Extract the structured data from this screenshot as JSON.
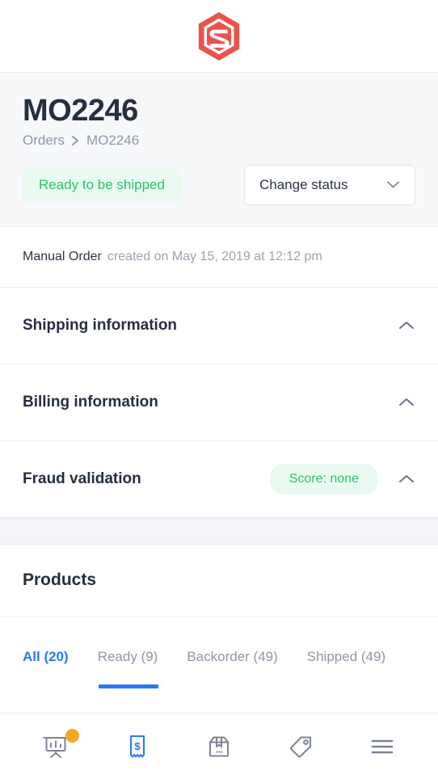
{
  "brand": {
    "logo_icon": "hexagon-s-logo",
    "logo_color": "#e8544c"
  },
  "order_header": {
    "title": "MO2246",
    "breadcrumb": {
      "parent": "Orders",
      "separator_icon": "chevron-right-icon",
      "current": "MO2246"
    },
    "status_badge": "Ready to be shipped",
    "status_badge_color": "#2ec26e",
    "status_badge_bg": "#e9faf0",
    "change_status_label": "Change status",
    "change_status_icon": "chevron-down-icon"
  },
  "meta": {
    "order_type": "Manual Order",
    "created": "created on May 15, 2019 at 12:12 pm"
  },
  "sections": [
    {
      "title": "Shipping information",
      "badge": null,
      "toggle_icon": "chevron-up-icon"
    },
    {
      "title": "Billing information",
      "badge": null,
      "toggle_icon": "chevron-up-icon"
    },
    {
      "title": "Fraud validation",
      "badge": "Score: none",
      "toggle_icon": "chevron-up-icon"
    }
  ],
  "products": {
    "title": "Products",
    "tabs": [
      {
        "label": "All (20)",
        "active": true
      },
      {
        "label": "Ready (9)",
        "active": false
      },
      {
        "label": "Backorder (49)",
        "active": false
      },
      {
        "label": "Shipped (49)",
        "active": false
      }
    ],
    "active_tab_color": "#2979f2"
  },
  "bottom_nav": {
    "items": [
      {
        "icon": "dashboard-easel-chart-icon",
        "active": false,
        "badge_dot": true,
        "badge_color": "#f5a623"
      },
      {
        "icon": "receipt-dollar-icon",
        "active": true,
        "badge_dot": false
      },
      {
        "icon": "package-box-icon",
        "active": false,
        "badge_dot": false
      },
      {
        "icon": "price-tag-icon",
        "active": false,
        "badge_dot": false
      },
      {
        "icon": "hamburger-menu-icon",
        "active": false,
        "badge_dot": false
      }
    ],
    "active_color": "#2979f2",
    "inactive_color": "#7b8496"
  }
}
